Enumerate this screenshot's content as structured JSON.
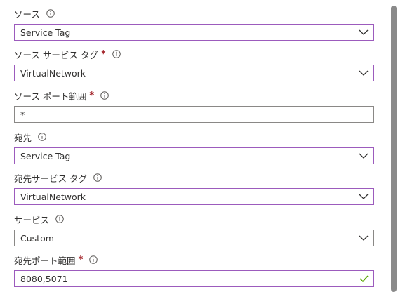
{
  "fields": {
    "source": {
      "label": "ソース",
      "value": "Service Tag",
      "required": false
    },
    "source_service_tag": {
      "label": "ソース サービス タグ",
      "value": "VirtualNetwork",
      "required": true,
      "required_marker": "*"
    },
    "source_port_range": {
      "label": "ソース ポート範囲",
      "value": "*",
      "required": true,
      "required_marker": "*"
    },
    "destination": {
      "label": "宛先",
      "value": "Service Tag",
      "required": false
    },
    "destination_service_tag": {
      "label": "宛先サービス タグ",
      "value": "VirtualNetwork",
      "required": false
    },
    "service": {
      "label": "サービス",
      "value": "Custom",
      "required": false
    },
    "destination_port_range": {
      "label": "宛先ポート範囲",
      "value": "8080,5071",
      "required": true,
      "required_marker": "*",
      "validation": "valid"
    }
  },
  "icons": {
    "info": "info-icon",
    "dropdown": "chevron-down-icon",
    "valid": "checkmark-icon"
  },
  "colors": {
    "select_border": "#9c5bbd",
    "required": "#a4262c",
    "valid_check": "#57a300",
    "text": "#323130",
    "scrollbar_thumb": "#8a8a8a"
  }
}
